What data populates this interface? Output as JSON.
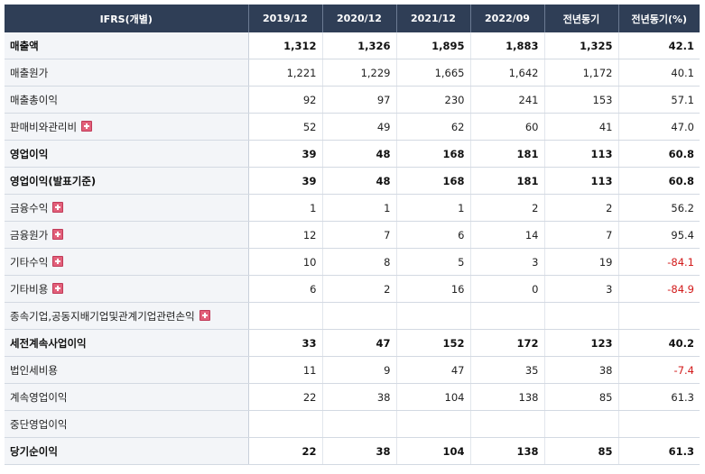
{
  "table": {
    "headers": [
      "IFRS(개별)",
      "2019/12",
      "2020/12",
      "2021/12",
      "2022/09",
      "전년동기",
      "전년동기(%)"
    ],
    "rows": [
      {
        "label": "매출액",
        "bold": true,
        "expand": false,
        "values": [
          "1,312",
          "1,326",
          "1,895",
          "1,883",
          "1,325",
          "42.1"
        ]
      },
      {
        "label": "매출원가",
        "bold": false,
        "expand": false,
        "values": [
          "1,221",
          "1,229",
          "1,665",
          "1,642",
          "1,172",
          "40.1"
        ]
      },
      {
        "label": "매출총이익",
        "bold": false,
        "expand": false,
        "values": [
          "92",
          "97",
          "230",
          "241",
          "153",
          "57.1"
        ]
      },
      {
        "label": "판매비와관리비",
        "bold": false,
        "expand": true,
        "values": [
          "52",
          "49",
          "62",
          "60",
          "41",
          "47.0"
        ]
      },
      {
        "label": "영업이익",
        "bold": true,
        "expand": false,
        "values": [
          "39",
          "48",
          "168",
          "181",
          "113",
          "60.8"
        ]
      },
      {
        "label": "영업이익(발표기준)",
        "bold": true,
        "expand": false,
        "values": [
          "39",
          "48",
          "168",
          "181",
          "113",
          "60.8"
        ]
      },
      {
        "label": "금융수익",
        "bold": false,
        "expand": true,
        "values": [
          "1",
          "1",
          "1",
          "2",
          "2",
          "56.2"
        ]
      },
      {
        "label": "금융원가",
        "bold": false,
        "expand": true,
        "values": [
          "12",
          "7",
          "6",
          "14",
          "7",
          "95.4"
        ]
      },
      {
        "label": "기타수익",
        "bold": false,
        "expand": true,
        "values": [
          "10",
          "8",
          "5",
          "3",
          "19",
          "-84.1"
        ]
      },
      {
        "label": "기타비용",
        "bold": false,
        "expand": true,
        "values": [
          "6",
          "2",
          "16",
          "0",
          "3",
          "-84.9"
        ]
      },
      {
        "label": "종속기업,공동지배기업및관계기업관련손익",
        "bold": false,
        "expand": true,
        "values": [
          "",
          "",
          "",
          "",
          "",
          ""
        ]
      },
      {
        "label": "세전계속사업이익",
        "bold": true,
        "expand": false,
        "values": [
          "33",
          "47",
          "152",
          "172",
          "123",
          "40.2"
        ]
      },
      {
        "label": "법인세비용",
        "bold": false,
        "expand": false,
        "values": [
          "11",
          "9",
          "47",
          "35",
          "38",
          "-7.4"
        ]
      },
      {
        "label": "계속영업이익",
        "bold": false,
        "expand": false,
        "values": [
          "22",
          "38",
          "104",
          "138",
          "85",
          "61.3"
        ]
      },
      {
        "label": "중단영업이익",
        "bold": false,
        "expand": false,
        "values": [
          "",
          "",
          "",
          "",
          "",
          ""
        ]
      },
      {
        "label": "당기순이익",
        "bold": true,
        "expand": false,
        "values": [
          "22",
          "38",
          "104",
          "138",
          "85",
          "61.3"
        ]
      }
    ]
  },
  "colors": {
    "header_bg": "#2f3e56",
    "negative": "#d21a1a",
    "label_bg": "#f3f5f8"
  },
  "icons": {
    "expand": "plus-icon"
  }
}
